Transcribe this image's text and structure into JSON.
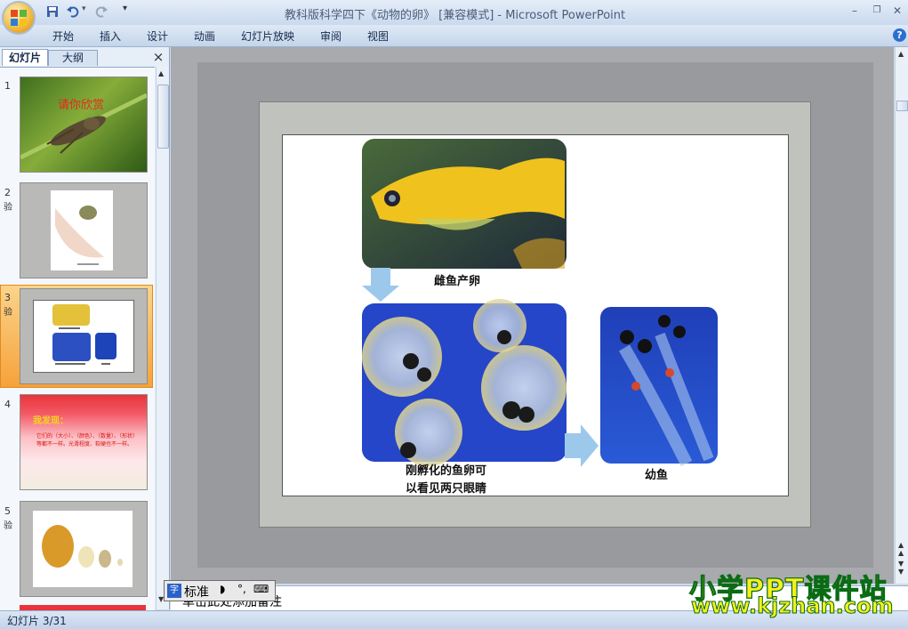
{
  "window": {
    "title": "教科版科学四下《动物的卵》 [兼容模式] - Microsoft PowerPoint"
  },
  "ribbon": {
    "tabs": [
      "开始",
      "插入",
      "设计",
      "动画",
      "幻灯片放映",
      "审阅",
      "视图"
    ]
  },
  "left_panel": {
    "tab_slides": "幻灯片",
    "tab_outline": "大纲",
    "close": "×",
    "thumbnails": [
      {
        "num": "1",
        "anim": "",
        "text": "请你欣赏"
      },
      {
        "num": "2",
        "anim": "验",
        "text": ""
      },
      {
        "num": "3",
        "anim": "验",
        "text": ""
      },
      {
        "num": "4",
        "anim": "",
        "text": "我发现：",
        "body": "它们的（大小）、（颜色）、（数量）、（形状）等都不一样。光滑程度、软硬也不一样。"
      },
      {
        "num": "5",
        "anim": "验",
        "text": ""
      }
    ]
  },
  "slide": {
    "captions": {
      "female_fish": "雌鱼产卵",
      "hatched_eggs_line1": "刚孵化的鱼卵可",
      "hatched_eggs_line2": "以看见两只眼睛",
      "young_fish": "幼鱼"
    }
  },
  "notes": {
    "placeholder": "单击此处添加备注"
  },
  "ime": {
    "mode": "标准"
  },
  "status": {
    "slide_counter": "幻灯片 3/31"
  },
  "watermark": {
    "line1": "小学PPT课件站",
    "line2": "www.kjzhan.com"
  },
  "colors": {
    "ribbon": "#cfdbeb",
    "selected_thumb": "#f6a23a",
    "arrow": "#9cc8ec",
    "watermark_fill": "#f6f01c",
    "watermark_stroke": "#0a6b15"
  }
}
